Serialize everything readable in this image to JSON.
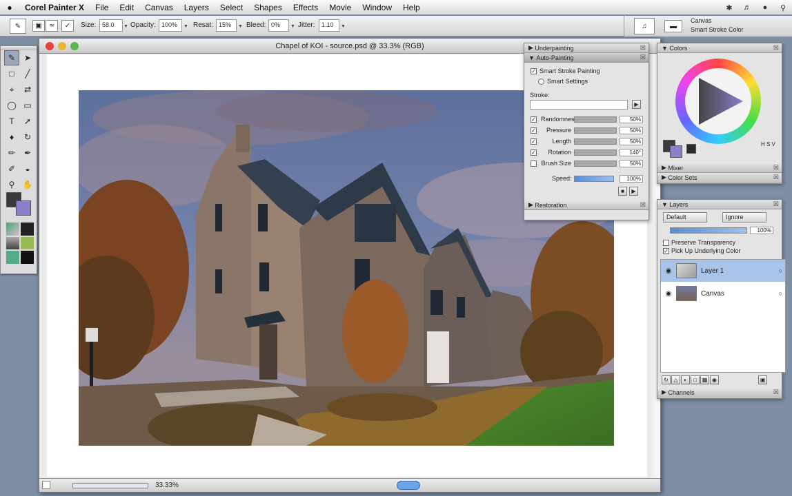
{
  "menubar": {
    "apple": "",
    "items": [
      "Corel Painter X",
      "File",
      "Edit",
      "Canvas",
      "Layers",
      "Select",
      "Shapes",
      "Effects",
      "Movie",
      "Window",
      "Help"
    ]
  },
  "property_bar": {
    "size_label": "Size:",
    "size_value": "58.0",
    "opacity_label": "Opacity:",
    "opacity_value": "100%",
    "resat_label": "Resat:",
    "resat_value": "15%",
    "bleed_label": "Bleed:",
    "bleed_value": "0%",
    "jitter_label": "Jitter:",
    "jitter_value": "1.10",
    "brush_category": "Canvas",
    "brush_variant": "Smart Stroke Color"
  },
  "document": {
    "title": "Chapel of KOI - source.psd @ 33.3% (RGB)",
    "zoom": "33.33%",
    "colors": {
      "titlebar_close": "#e4463d",
      "titlebar_min": "#e6b53a",
      "titlebar_max": "#5cb84a"
    }
  },
  "underpainting_panel": {
    "underpainting_header": "Underpainting",
    "auto_painting_header": "Auto-Painting",
    "smart_stroke_label": "Smart Stroke Painting",
    "smart_settings_label": "Smart Settings",
    "stroke_label": "Stroke:",
    "rows": [
      {
        "label": "Randomness",
        "value": "50%"
      },
      {
        "label": "Pressure",
        "value": "50%"
      },
      {
        "label": "Length",
        "value": "50%"
      },
      {
        "label": "Rotation",
        "value": "140°"
      },
      {
        "label": "Brush Size",
        "value": "50%"
      }
    ],
    "speed_label": "Speed:",
    "speed_value": "100%",
    "restoration_header": "Restoration"
  },
  "colors_panel": {
    "header": "Colors",
    "mixer_header": "Mixer",
    "color_sets_header": "Color Sets",
    "values_label": "H S V",
    "colors": {
      "main": "#8a7fc9",
      "secondary": "#3a3a3a"
    }
  },
  "layers_panel": {
    "header": "Layers",
    "composite_method": "Default",
    "ignore_mode": "Ignore",
    "opacity": "100%",
    "preserve_transparency": "Preserve Transparency",
    "pick_up_color": "Pick Up Underlying Color",
    "layers": [
      {
        "name": "Layer 1",
        "selected": true
      },
      {
        "name": "Canvas",
        "selected": false
      }
    ],
    "channels_header": "Channels"
  },
  "icons": [
    "apple-icon",
    "brush-icon",
    "eye-icon",
    "lock-icon",
    "close-icon",
    "play-icon",
    "record-icon"
  ]
}
